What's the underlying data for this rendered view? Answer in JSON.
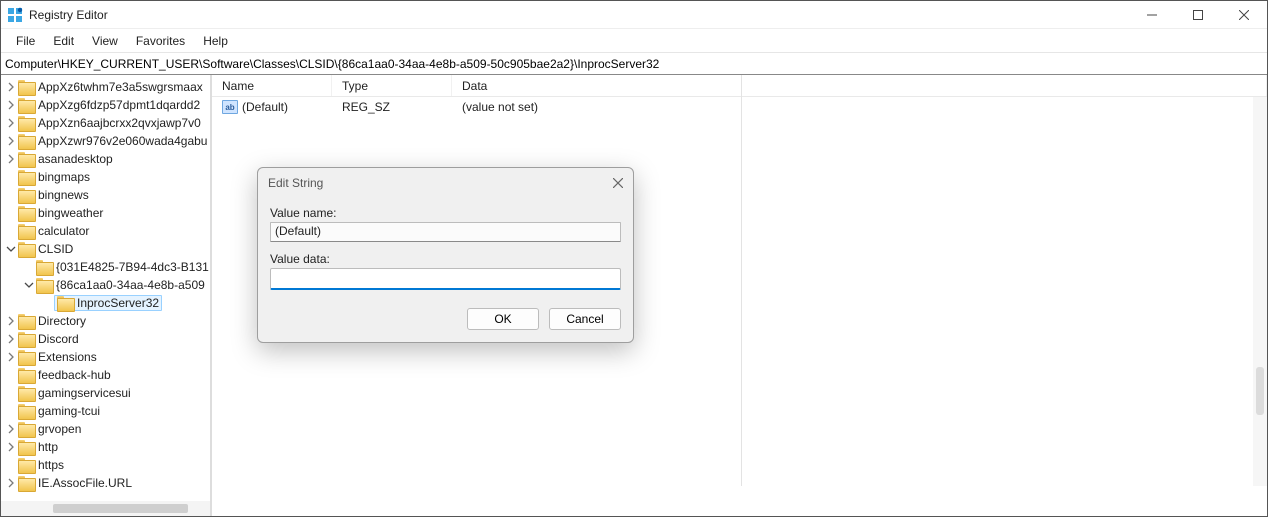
{
  "title": "Registry Editor",
  "menu": {
    "file": "File",
    "edit": "Edit",
    "view": "View",
    "favorites": "Favorites",
    "help": "Help"
  },
  "address": "Computer\\HKEY_CURRENT_USER\\Software\\Classes\\CLSID\\{86ca1aa0-34aa-4e8b-a509-50c905bae2a2}\\InprocServer32",
  "columns": {
    "name": "Name",
    "type": "Type",
    "data": "Data"
  },
  "row": {
    "name": "(Default)",
    "type": "REG_SZ",
    "data": "(value not set)",
    "icon_text": "ab"
  },
  "tree": {
    "items": [
      {
        "indent": 0,
        "chevron": "right",
        "label": "AppXz6twhm7e3a5swgrsmaax"
      },
      {
        "indent": 0,
        "chevron": "right",
        "label": "AppXzg6fdzp57dpmt1dqardd2"
      },
      {
        "indent": 0,
        "chevron": "right",
        "label": "AppXzn6aajbcrxx2qvxjawp7v0"
      },
      {
        "indent": 0,
        "chevron": "right",
        "label": "AppXzwr976v2e060wada4gabu"
      },
      {
        "indent": 0,
        "chevron": "right",
        "label": "asanadesktop"
      },
      {
        "indent": 0,
        "chevron": "none",
        "label": "bingmaps"
      },
      {
        "indent": 0,
        "chevron": "none",
        "label": "bingnews"
      },
      {
        "indent": 0,
        "chevron": "none",
        "label": "bingweather"
      },
      {
        "indent": 0,
        "chevron": "none",
        "label": "calculator"
      },
      {
        "indent": 0,
        "chevron": "down",
        "label": "CLSID"
      },
      {
        "indent": 1,
        "chevron": "none",
        "label": "{031E4825-7B94-4dc3-B131"
      },
      {
        "indent": 1,
        "chevron": "down",
        "label": "{86ca1aa0-34aa-4e8b-a509"
      },
      {
        "indent": 2,
        "chevron": "none",
        "label": "InprocServer32",
        "selected": true
      },
      {
        "indent": 0,
        "chevron": "right",
        "label": "Directory"
      },
      {
        "indent": 0,
        "chevron": "right",
        "label": "Discord"
      },
      {
        "indent": 0,
        "chevron": "right",
        "label": "Extensions"
      },
      {
        "indent": 0,
        "chevron": "none",
        "label": "feedback-hub"
      },
      {
        "indent": 0,
        "chevron": "none",
        "label": "gamingservicesui"
      },
      {
        "indent": 0,
        "chevron": "none",
        "label": "gaming-tcui"
      },
      {
        "indent": 0,
        "chevron": "right",
        "label": "grvopen"
      },
      {
        "indent": 0,
        "chevron": "right",
        "label": "http"
      },
      {
        "indent": 0,
        "chevron": "none",
        "label": "https"
      },
      {
        "indent": 0,
        "chevron": "right",
        "label": "IE.AssocFile.URL"
      }
    ]
  },
  "dialog": {
    "title": "Edit String",
    "label_name": "Value name:",
    "value_name": "(Default)",
    "label_data": "Value data:",
    "value_data": "",
    "ok": "OK",
    "cancel": "Cancel"
  }
}
